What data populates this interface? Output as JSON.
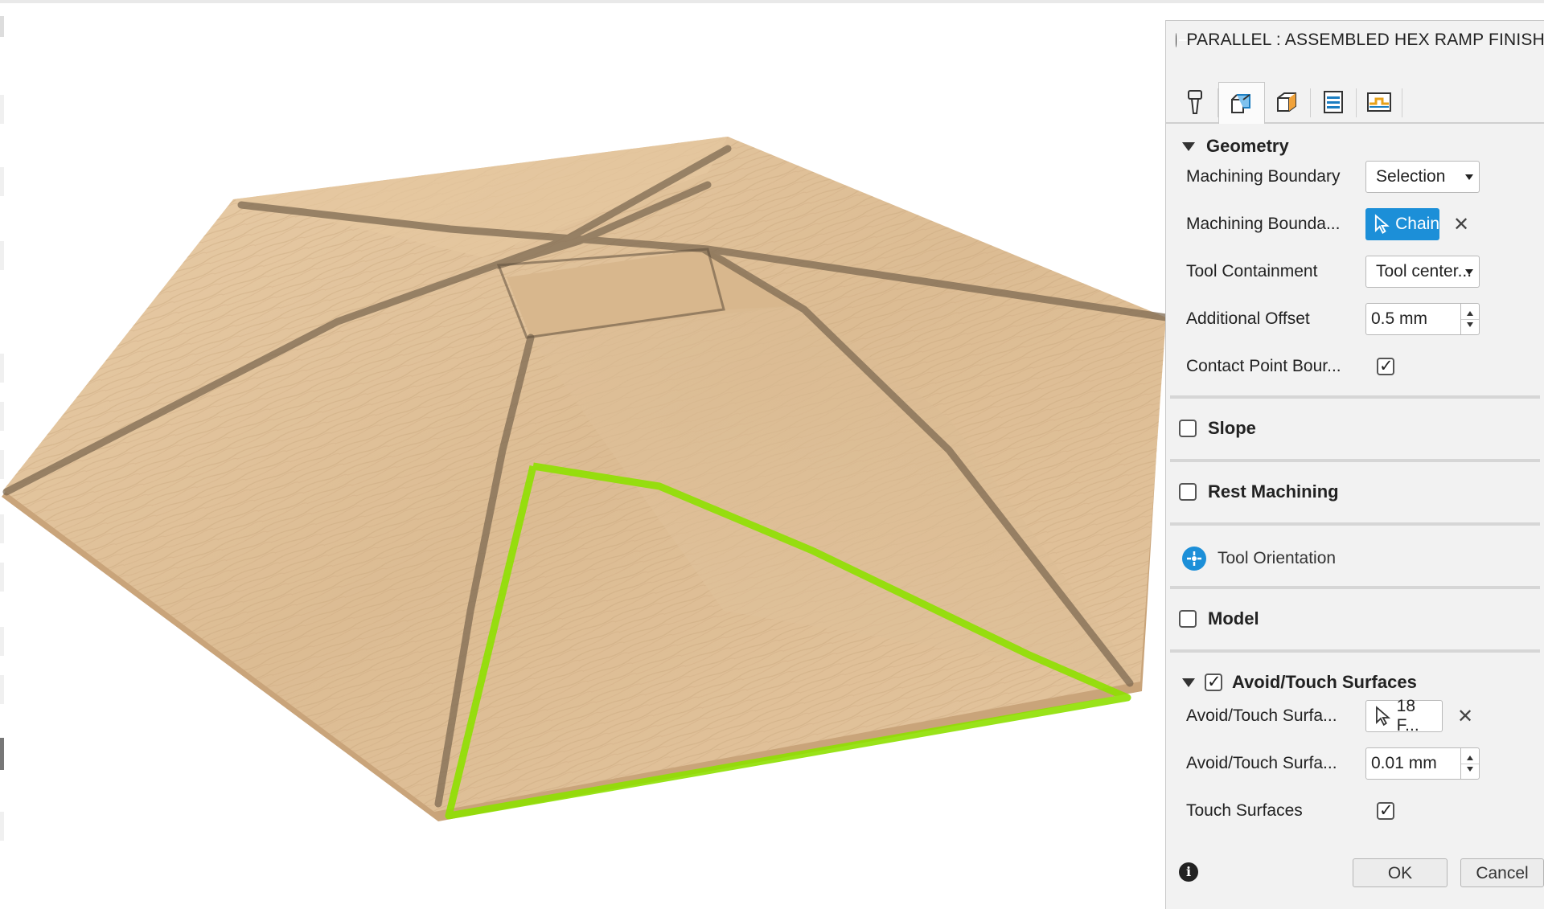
{
  "dialog": {
    "title": "PARALLEL : ASSEMBLED HEX RAMP FINISH",
    "tabs": [
      {
        "icon": "tool-icon"
      },
      {
        "icon": "geometry-icon",
        "active": true
      },
      {
        "icon": "heights-icon"
      },
      {
        "icon": "passes-icon"
      },
      {
        "icon": "linking-icon"
      }
    ]
  },
  "geometry": {
    "label": "Geometry",
    "machining_boundary": {
      "label": "Machining Boundary",
      "value": "Selection"
    },
    "machining_boundary_selection": {
      "label": "Machining Bounda...",
      "button": "Chain"
    },
    "tool_containment": {
      "label": "Tool Containment",
      "value": "Tool center..."
    },
    "additional_offset": {
      "label": "Additional Offset",
      "value": "0.5 mm"
    },
    "contact_point_boundary": {
      "label": "Contact Point Bour...",
      "checked": true
    }
  },
  "slope": {
    "label": "Slope",
    "checked": false
  },
  "rest_machining": {
    "label": "Rest Machining",
    "checked": false
  },
  "tool_orientation": {
    "label": "Tool Orientation"
  },
  "model": {
    "label": "Model",
    "checked": false
  },
  "avoid_touch": {
    "label": "Avoid/Touch Surfaces",
    "checked": true,
    "surfaces": {
      "label": "Avoid/Touch Surfa...",
      "value": "18 F..."
    },
    "clearance": {
      "label": "Avoid/Touch Surfa...",
      "value": "0.01 mm"
    },
    "touch_surfaces": {
      "label": "Touch Surfaces",
      "checked": true
    }
  },
  "footer": {
    "ok": "OK",
    "cancel": "Cancel"
  },
  "colors": {
    "accent": "#1c8fd8",
    "selection": "#8ee000",
    "wood": "#e6c7a0"
  }
}
